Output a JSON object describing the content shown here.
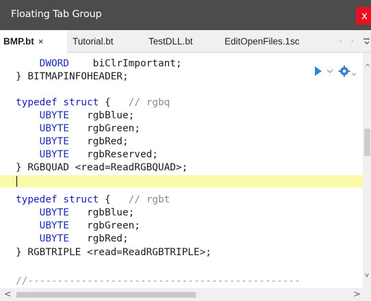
{
  "window": {
    "title": "Floating Tab Group",
    "close_glyph": "x"
  },
  "tabs": [
    {
      "label": "BMP.bt",
      "active": true,
      "close_glyph": "×"
    },
    {
      "label": "Tutorial.bt",
      "active": false
    },
    {
      "label": "TestDLL.bt",
      "active": false
    },
    {
      "label": "EditOpenFiles.1sc",
      "active": false
    }
  ],
  "tab_nav": {
    "prev_glyph": "‹",
    "next_glyph": "›"
  },
  "icons": {
    "run": "run-icon",
    "run_dropdown": "chevron-down-icon",
    "settings": "gear-icon",
    "tab_list": "tab-list-icon"
  },
  "code": {
    "line1_type": "DWORD",
    "line1_field": "biClrImportant;",
    "line2": "} BITMAPINFOHEADER;",
    "line4_kw": "typedef struct",
    "line4_brace": "{",
    "line4_comment": "// rgbq",
    "line5_type": "UBYTE",
    "line5_field": "rgbBlue;",
    "line6_type": "UBYTE",
    "line6_field": "rgbGreen;",
    "line7_type": "UBYTE",
    "line7_field": "rgbRed;",
    "line8_type": "UBYTE",
    "line8_field": "rgbReserved;",
    "line9": "} RGBQUAD <read=ReadRGBQUAD>;",
    "line11_kw": "typedef struct",
    "line11_brace": "{",
    "line11_comment": "// rgbt",
    "line12_type": "UBYTE",
    "line12_field": "rgbBlue;",
    "line13_type": "UBYTE",
    "line13_field": "rgbGreen;",
    "line14_type": "UBYTE",
    "line14_field": "rgbRed;",
    "line15": "} RGBTRIPLE <read=ReadRGBTRIPLE>;",
    "line17": "//----------------------------------------------"
  },
  "scrollbars": {
    "up_glyph": "^",
    "down_glyph": "v",
    "left_glyph": "<",
    "right_glyph": ">"
  },
  "colors": {
    "keyword": "#1a1ab8",
    "comment": "#8a8a8a",
    "current_line": "#fafaa8",
    "title_bar": "#4c4c4c",
    "close": "#e81123",
    "run_icon": "#2f86d6"
  }
}
